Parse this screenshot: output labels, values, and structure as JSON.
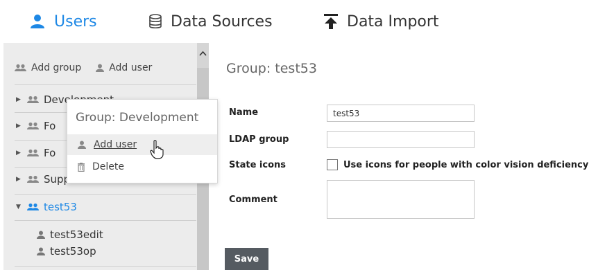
{
  "nav": {
    "tabs": [
      {
        "label": "Users",
        "icon": "user-icon",
        "active": true
      },
      {
        "label": "Data Sources",
        "icon": "database-icon",
        "active": false
      },
      {
        "label": "Data Import",
        "icon": "upload-icon",
        "active": false
      }
    ]
  },
  "sidebar": {
    "actions": {
      "add_group": "Add group",
      "add_user": "Add user"
    },
    "groups": [
      {
        "label": "Development",
        "expanded": false
      },
      {
        "label": "Fo",
        "expanded": false
      },
      {
        "label": "Fo",
        "expanded": false
      },
      {
        "label": "Support",
        "expanded": false
      },
      {
        "label": "test53",
        "expanded": true,
        "selected": true
      }
    ],
    "users": [
      "test53edit",
      "test53op"
    ]
  },
  "popup": {
    "title": "Group: Development",
    "items": [
      {
        "label": "Add user",
        "icon": "user-icon"
      },
      {
        "label": "Delete",
        "icon": "trash-icon"
      }
    ]
  },
  "form": {
    "title": "Group: test53",
    "name_label": "Name",
    "name_value": "test53",
    "ldap_label": "LDAP group",
    "ldap_value": "",
    "state_icons_label": "State icons",
    "state_icons_option": "Use icons for people with color vision deficiency",
    "comment_label": "Comment",
    "save_label": "Save"
  },
  "colors": {
    "accent": "#1e88e5",
    "sidebar_bg": "#ececec",
    "button_bg": "#555b61"
  }
}
